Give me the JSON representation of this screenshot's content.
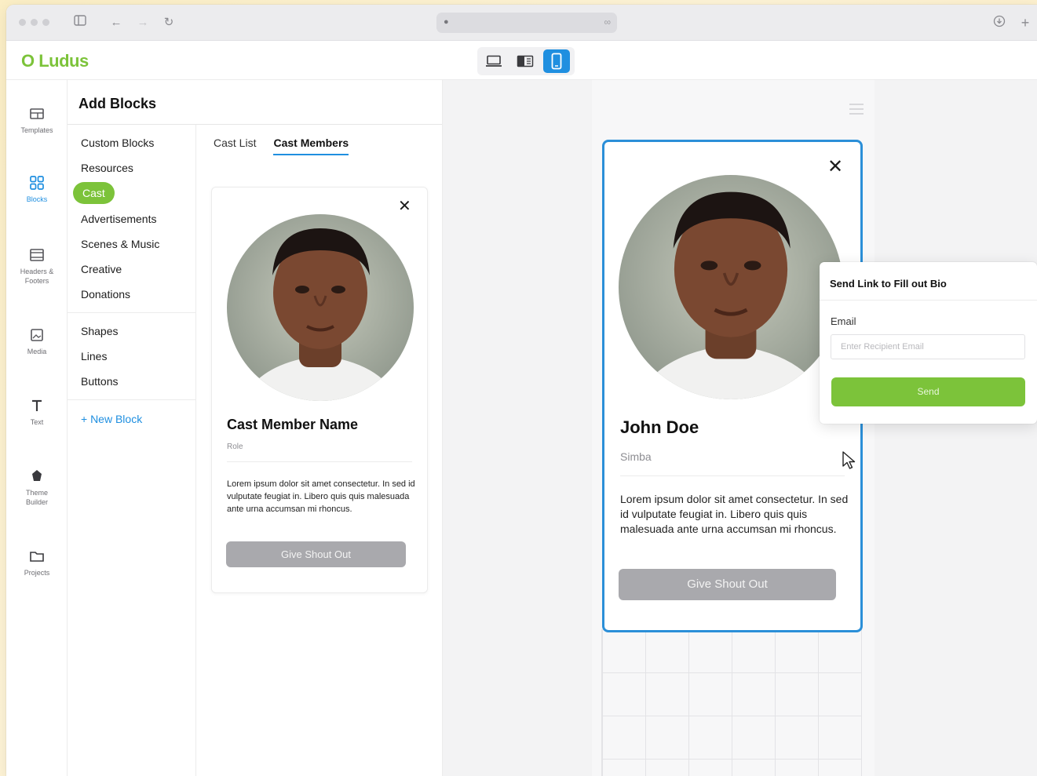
{
  "brand": {
    "logo": "O Ludus",
    "accent": "#7cc33a",
    "primary": "#1f8fe0"
  },
  "device_switch": {
    "options": [
      "desktop",
      "tablet",
      "mobile"
    ],
    "selected": "mobile"
  },
  "rail": {
    "items": [
      {
        "label": "Templates",
        "icon": "templates-icon"
      },
      {
        "label": "Blocks",
        "icon": "blocks-icon",
        "active": true
      },
      {
        "label": "Headers & Footers",
        "icon": "headers-footers-icon"
      },
      {
        "label": "Media",
        "icon": "media-icon"
      },
      {
        "label": "Text",
        "icon": "text-icon"
      },
      {
        "label": "Theme Builder",
        "icon": "theme-builder-icon"
      },
      {
        "label": "Projects",
        "icon": "projects-icon"
      }
    ]
  },
  "panel": {
    "title": "Add Blocks",
    "categories_group1": [
      "Custom Blocks",
      "Resources",
      "Cast",
      "Advertisements",
      "Scenes & Music",
      "Creative",
      "Donations"
    ],
    "active_category": "Cast",
    "categories_group2": [
      "Shapes",
      "Lines",
      "Buttons"
    ],
    "new_block": "+ New Block",
    "tabs": [
      "Cast List",
      "Cast Members"
    ],
    "active_tab": "Cast Members"
  },
  "preview_card": {
    "name": "Cast Member Name",
    "role": "Role",
    "bio": "Lorem ipsum dolor sit amet consectetur. In sed id vulputate feugiat in. Libero quis quis malesuada ante urna accumsan mi rhoncus.",
    "button": "Give Shout Out"
  },
  "canvas_card": {
    "name": "John Doe",
    "role": "Simba",
    "bio": "Lorem ipsum dolor sit amet consectetur. In sed id vulputate feugiat in. Libero quis quis malesuada ante urna accumsan mi rhoncus.",
    "button": "Give Shout Out"
  },
  "popover": {
    "title": "Send Link to Fill out Bio",
    "email_label": "Email",
    "email_placeholder": "Enter Recipient Email",
    "email_value": "",
    "send_label": "Send"
  }
}
